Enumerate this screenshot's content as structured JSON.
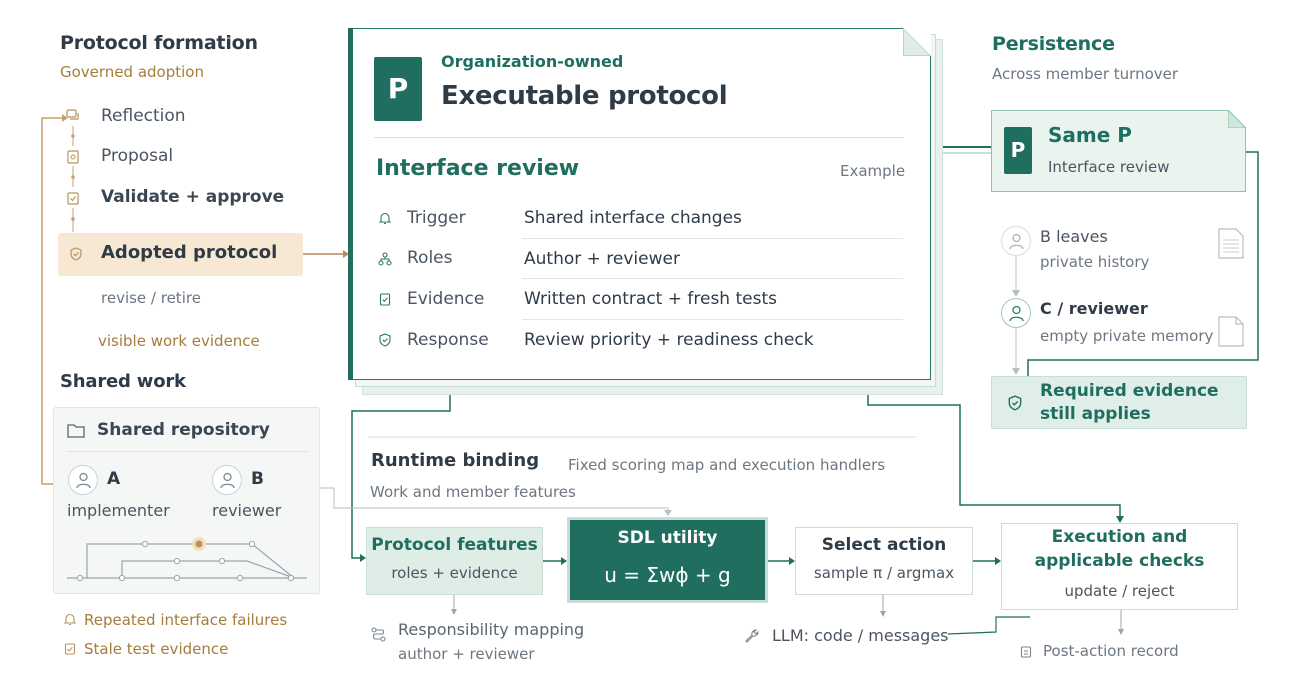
{
  "protocol_formation": {
    "title": "Protocol formation",
    "subtitle": "Governed adoption",
    "steps": [
      {
        "label": "Reflection",
        "icon": "chat-icon"
      },
      {
        "label": "Proposal",
        "icon": "document-search-icon"
      },
      {
        "label": "Validate + approve",
        "icon": "clipboard-check-icon"
      }
    ],
    "adopted": "Adopted protocol",
    "revise": "revise / retire",
    "evidence_link": "visible work evidence"
  },
  "shared_work": {
    "title": "Shared work",
    "repo_title": "Shared repository",
    "member_a": {
      "letter": "A",
      "role": "implementer"
    },
    "member_b": {
      "letter": "B",
      "role": "reviewer"
    },
    "signals": [
      "Repeated interface failures",
      "Stale test evidence"
    ]
  },
  "protocol_card": {
    "badge": "P",
    "kicker": "Organization-owned",
    "title": "Executable protocol",
    "review_title": "Interface review",
    "example": "Example",
    "rows": [
      {
        "key": "Trigger",
        "value": "Shared interface changes",
        "icon": "bell-icon"
      },
      {
        "key": "Roles",
        "value": "Author + reviewer",
        "icon": "hierarchy-icon"
      },
      {
        "key": "Evidence",
        "value": "Written contract + fresh tests",
        "icon": "clipboard-icon"
      },
      {
        "key": "Response",
        "value": "Review priority + readiness check",
        "icon": "shield-check-icon"
      }
    ]
  },
  "persistence": {
    "title": "Persistence",
    "subtitle": "Across member turnover",
    "same_badge": "P",
    "same_title": "Same P",
    "same_sub": "Interface review",
    "b_name": "B leaves",
    "b_sub": "private history",
    "c_name": "C / reviewer",
    "c_sub": "empty private memory",
    "required_line1": "Required evidence",
    "required_line2": "still applies"
  },
  "runtime": {
    "title": "Runtime binding",
    "fixed_note": "Fixed scoring map and execution handlers",
    "work_note": "Work and member features",
    "features_title": "Protocol features",
    "features_sub": "roles + evidence",
    "sdl_title": "SDL utility",
    "sdl_formula": "u = Σwϕ + g",
    "select_title": "Select action",
    "select_sub": "sample π / argmax",
    "exec_line1": "Execution and",
    "exec_line2": "applicable checks",
    "exec_sub": "update / reject",
    "mapping_title": "Responsibility mapping",
    "mapping_sub": "author + reviewer",
    "llm": "LLM: code / messages",
    "post_action": "Post-action record"
  },
  "colors": {
    "teal": "#1f6e5f",
    "gold": "#a67c3a",
    "adopted_fill": "#f6e8d2",
    "runtime_bg": "#f1f5f3"
  }
}
